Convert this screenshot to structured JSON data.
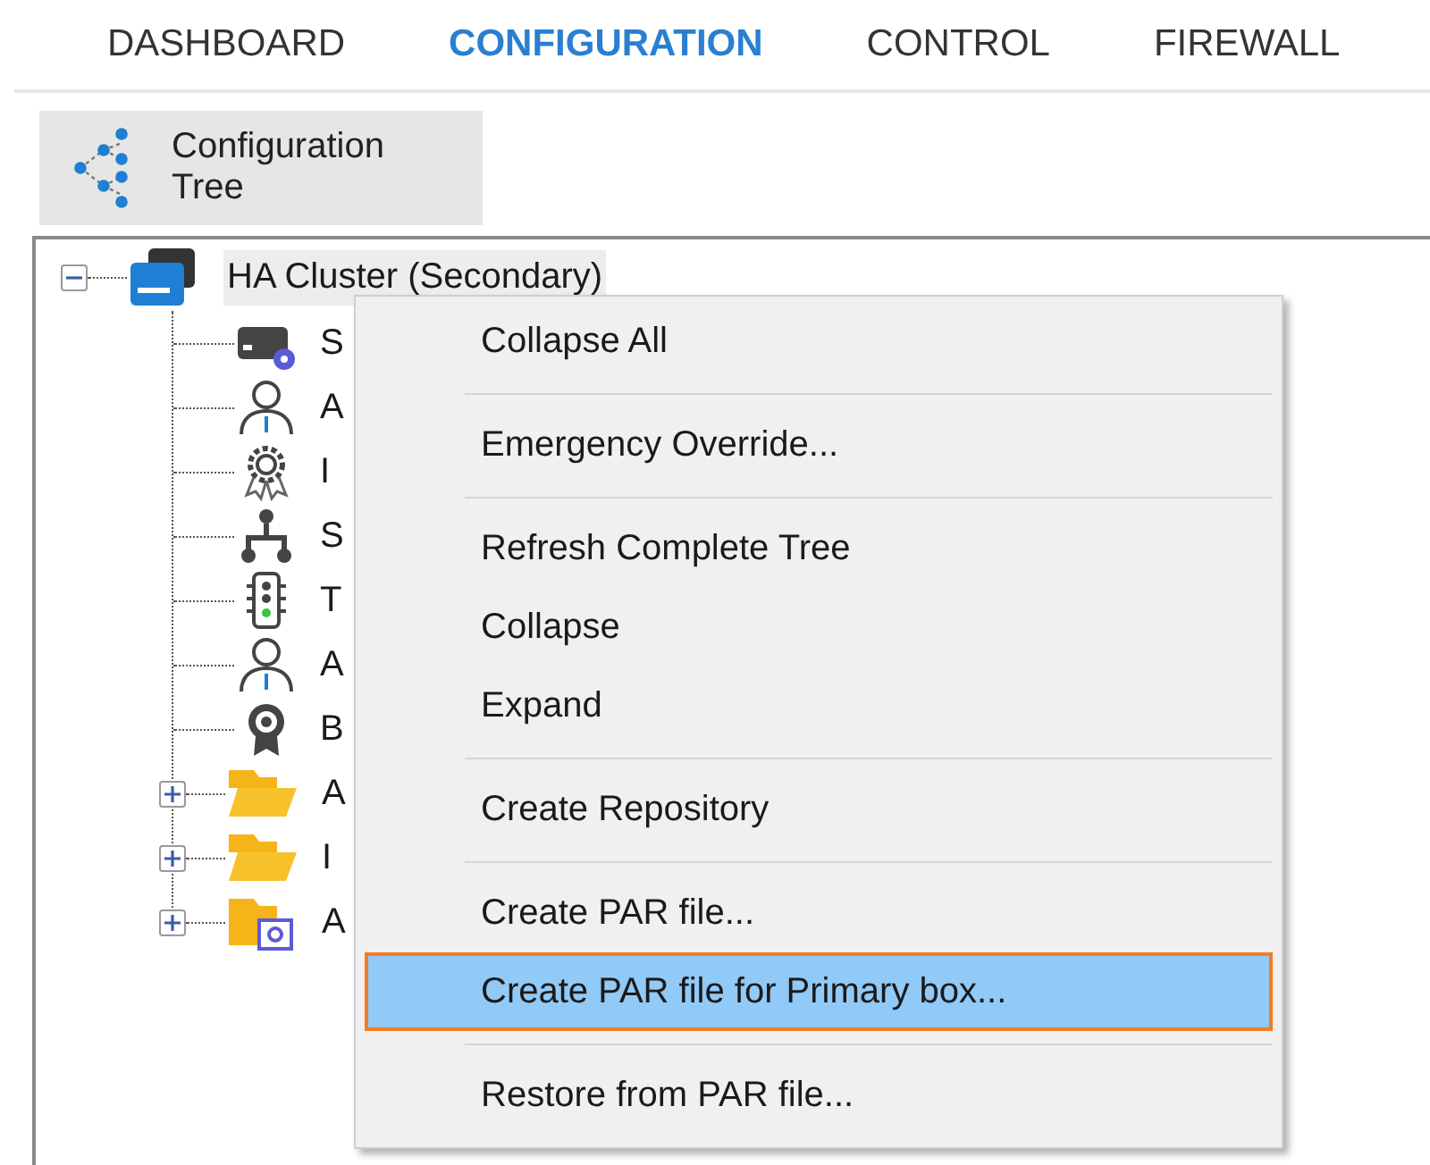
{
  "tabs": [
    {
      "label": "DASHBOARD",
      "selected": false
    },
    {
      "label": "CONFIGURATION",
      "selected": true
    },
    {
      "label": "CONTROL",
      "selected": false
    },
    {
      "label": "FIREWALL",
      "selected": false
    }
  ],
  "toolbar": {
    "button": "Configuration Tree"
  },
  "tree": {
    "root": {
      "label": "HA Cluster (Secondary)",
      "expanded": true,
      "selected": true,
      "kind": "cluster"
    },
    "children": [
      {
        "label": "S",
        "kind": "server",
        "expandable": false
      },
      {
        "label": "A",
        "kind": "user",
        "expandable": false
      },
      {
        "label": "I",
        "kind": "award",
        "expandable": false
      },
      {
        "label": "S",
        "kind": "network",
        "expandable": false
      },
      {
        "label": "T",
        "kind": "traffic",
        "expandable": false
      },
      {
        "label": "A",
        "kind": "user",
        "expandable": false
      },
      {
        "label": "B",
        "kind": "badge",
        "expandable": false
      },
      {
        "label": "A",
        "kind": "folder",
        "expandable": true
      },
      {
        "label": "I",
        "kind": "folder",
        "expandable": true
      },
      {
        "label": "A",
        "kind": "folder-settings",
        "expandable": true
      }
    ]
  },
  "context_menu": [
    {
      "kind": "item",
      "label": "Collapse All",
      "selected": false
    },
    {
      "kind": "separator"
    },
    {
      "kind": "item",
      "label": "Emergency Override...",
      "selected": false
    },
    {
      "kind": "separator"
    },
    {
      "kind": "item",
      "label": "Refresh Complete Tree",
      "selected": false
    },
    {
      "kind": "item",
      "label": "Collapse",
      "selected": false
    },
    {
      "kind": "item",
      "label": "Expand",
      "selected": false
    },
    {
      "kind": "separator"
    },
    {
      "kind": "item",
      "label": "Create Repository",
      "selected": false
    },
    {
      "kind": "separator"
    },
    {
      "kind": "item",
      "label": "Create PAR file...",
      "selected": false
    },
    {
      "kind": "item",
      "label": "Create PAR file for Primary box...",
      "selected": true
    },
    {
      "kind": "separator"
    },
    {
      "kind": "item",
      "label": "Restore from PAR file...",
      "selected": false
    }
  ]
}
